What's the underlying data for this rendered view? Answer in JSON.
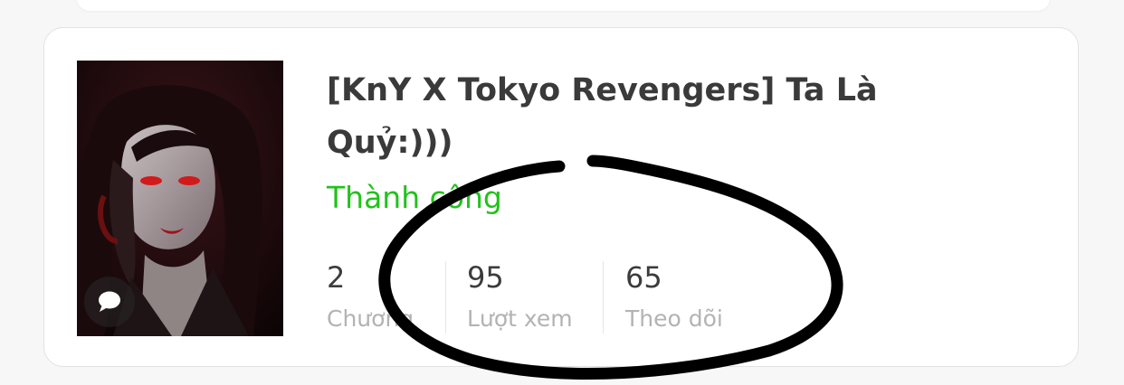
{
  "story": {
    "title": "[KnY X Tokyo Revengers] Ta Là Quỷ:)))",
    "status": "Thành công",
    "status_color": "#21c21a",
    "cover_icon": "chat-bubble-icon",
    "stats": [
      {
        "value": "2",
        "label": "Chương"
      },
      {
        "value": "95",
        "label": "Lượt xem"
      },
      {
        "value": "65",
        "label": "Theo dõi"
      }
    ]
  }
}
